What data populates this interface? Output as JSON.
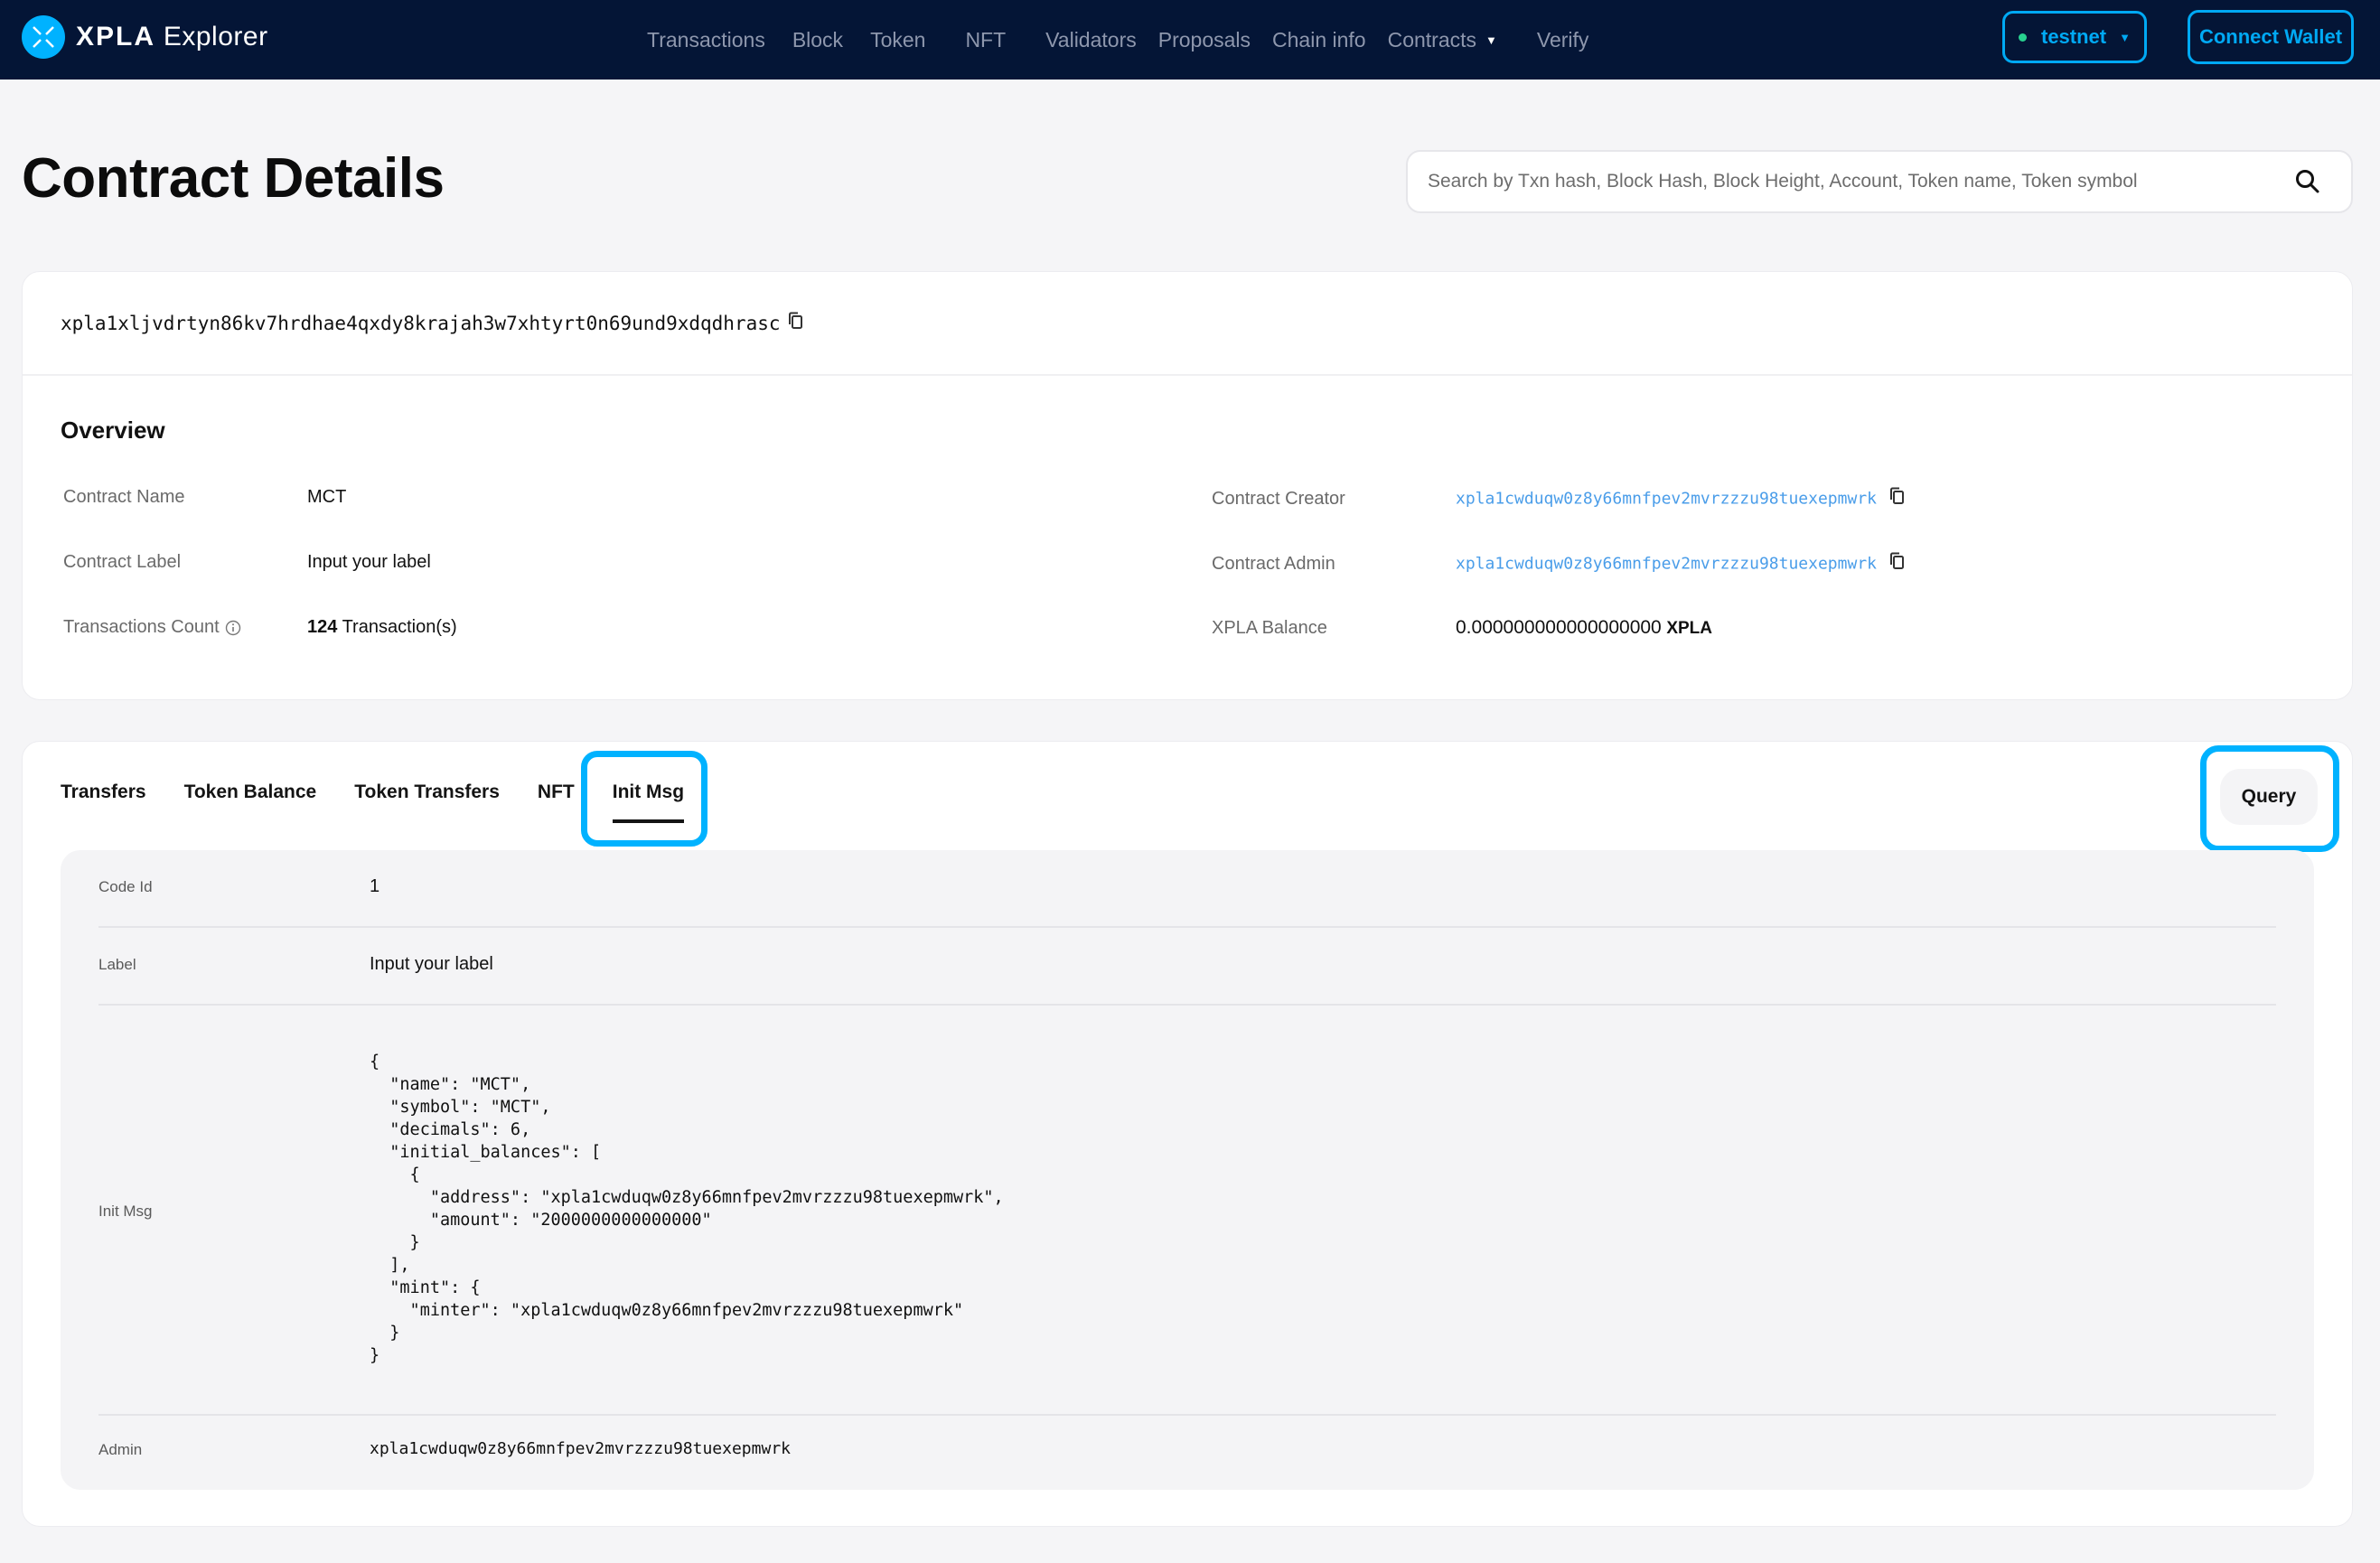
{
  "nav": {
    "brand_bold": "XPLA",
    "brand_rest": "Explorer",
    "menu": [
      {
        "label": "Transactions"
      },
      {
        "label": "Block"
      },
      {
        "label": "Token"
      },
      {
        "label": "NFT"
      },
      {
        "label": "Validators"
      },
      {
        "label": "Proposals"
      },
      {
        "label": "Chain info"
      },
      {
        "label": "Contracts",
        "dropdown": true
      },
      {
        "label": "Verify"
      }
    ],
    "network": "testnet",
    "connect_wallet": "Connect Wallet"
  },
  "page": {
    "title": "Contract Details",
    "search_placeholder": "Search by Txn hash, Block Hash, Block Height, Account, Token name, Token symbol"
  },
  "contract": {
    "address": "xpla1xljvdrtyn86kv7hrdhae4qxdy8krajah3w7xhtyrt0n69und9xdqdhrasc",
    "overview_title": "Overview",
    "left": [
      {
        "label": "Contract Name",
        "value": "MCT"
      },
      {
        "label": "Contract Label",
        "value": "Input your label"
      },
      {
        "label": "Transactions Count",
        "count": "124",
        "suffix": "Transaction(s)"
      }
    ],
    "right": [
      {
        "label": "Contract Creator",
        "value": "xpla1cwduqw0z8y66mnfpev2mvrzzzu98tuexepmwrk"
      },
      {
        "label": "Contract Admin",
        "value": "xpla1cwduqw0z8y66mnfpev2mvrzzzu98tuexepmwrk"
      },
      {
        "label": "XPLA Balance",
        "value": "0.000000000000000000",
        "unit": "XPLA"
      }
    ]
  },
  "tabs": {
    "items": [
      "Transfers",
      "Token Balance",
      "Token Transfers",
      "NFT",
      "Init Msg"
    ],
    "active": "Init Msg",
    "query_label": "Query"
  },
  "init": {
    "code_id_label": "Code Id",
    "code_id": "1",
    "label_label": "Label",
    "label": "Input your label",
    "init_msg_label": "Init Msg",
    "init_msg": "{\n  \"name\": \"MCT\",\n  \"symbol\": \"MCT\",\n  \"decimals\": 6,\n  \"initial_balances\": [\n    {\n      \"address\": \"xpla1cwduqw0z8y66mnfpev2mvrzzzu98tuexepmwrk\",\n      \"amount\": \"2000000000000000\"\n    }\n  ],\n  \"mint\": {\n    \"minter\": \"xpla1cwduqw0z8y66mnfpev2mvrzzzu98tuexepmwrk\"\n  }\n}",
    "admin_label": "Admin",
    "admin": "xpla1cwduqw0z8y66mnfpev2mvrzzzu98tuexepmwrk"
  },
  "colors": {
    "nav_bg": "#041536",
    "accent": "#00a9f4",
    "link": "#4a9de9",
    "status_dot": "#28d18f"
  }
}
